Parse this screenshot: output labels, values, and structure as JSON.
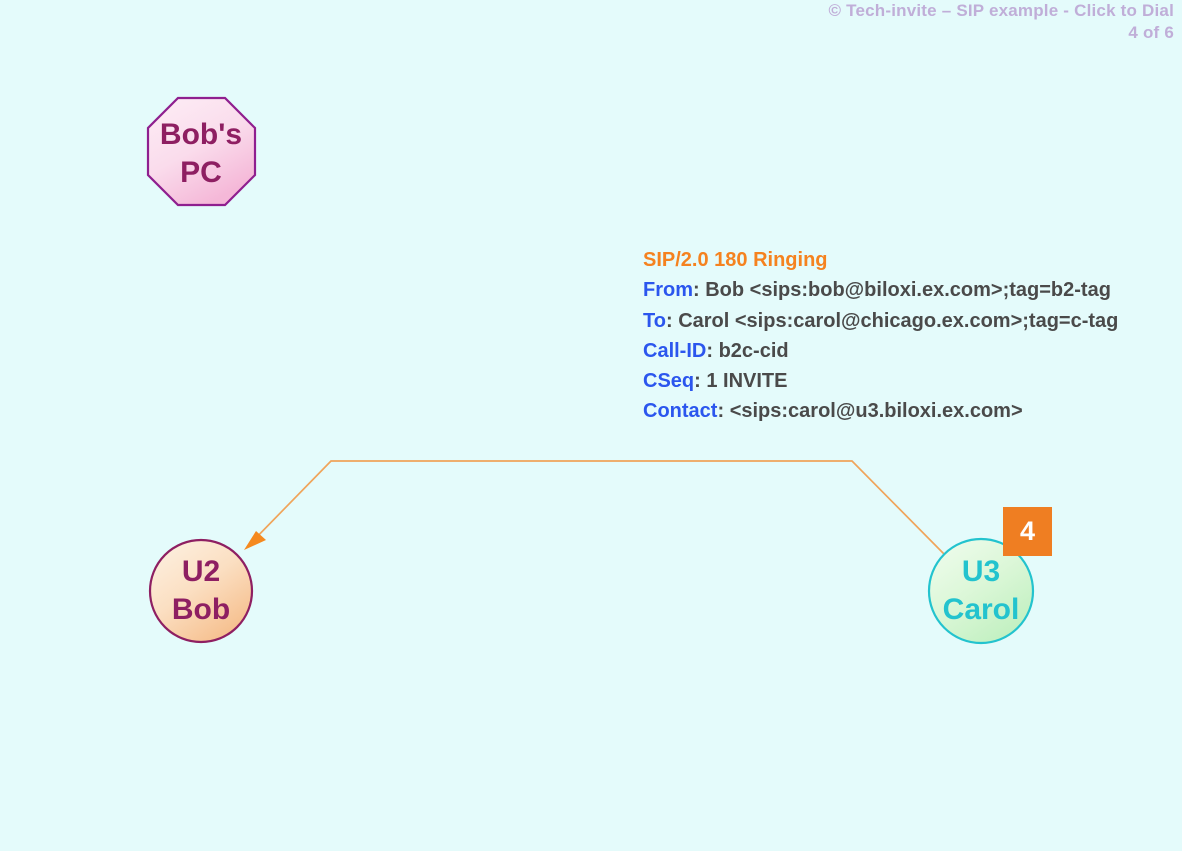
{
  "header": {
    "credit": "© Tech-invite – SIP example - Click to Dial",
    "page_counter": "4 of 6"
  },
  "colors": {
    "background": "#e4fbfb",
    "header_text": "#c0aed8",
    "start_line": "#f5821f",
    "header_name": "#2b56ee",
    "header_value": "#4a4a4a",
    "badge_background": "#ef7e22",
    "badge_text": "#ffffff",
    "endpoint_purple": "#8e1f62",
    "endpoint_teal": "#23c3ce",
    "arrow": "#f0a45a"
  },
  "nodes": [
    {
      "id": "bobs-pc",
      "shape": "octagon",
      "label": "Bob's\nPC",
      "fill_from": "#fbe3ef",
      "fill_to": "#f7bcd8",
      "stroke": "#8f1f8f",
      "text_color": "#8e1f62"
    },
    {
      "id": "u2-bob",
      "shape": "circle",
      "label": "U2\nBob",
      "fill_from": "#fdefdf",
      "fill_to": "#f7bf8a",
      "stroke": "#8e1f62",
      "text_color": "#8e1f62"
    },
    {
      "id": "u3-carol",
      "shape": "circle",
      "label": "U3\nCarol",
      "fill_from": "#eafbe8",
      "fill_to": "#c4f0c2",
      "stroke": "#23c3ce",
      "text_color": "#23c3ce"
    }
  ],
  "step_badge": {
    "number": "4"
  },
  "arrow": {
    "direction": "u3-carol-to-u2-bob",
    "label": "SIP/2.0 180 Ringing response from Carol to Bob"
  },
  "sip_message": {
    "start_line": "SIP/2.0 180 Ringing",
    "headers": [
      {
        "name": "From",
        "sep": ":",
        "value": "Bob <sips:bob@biloxi.ex.com>;tag=b2-tag"
      },
      {
        "name": "To",
        "sep": ":",
        "value": "Carol <sips:carol@chicago.ex.com>;tag=c-tag"
      },
      {
        "name": "Call-ID",
        "sep": ":",
        "value": "b2c-cid"
      },
      {
        "name": "CSeq",
        "sep": ":",
        "value": "1 INVITE"
      },
      {
        "name": "Contact",
        "sep": ":",
        "value": "<sips:carol@u3.biloxi.ex.com>"
      }
    ]
  }
}
